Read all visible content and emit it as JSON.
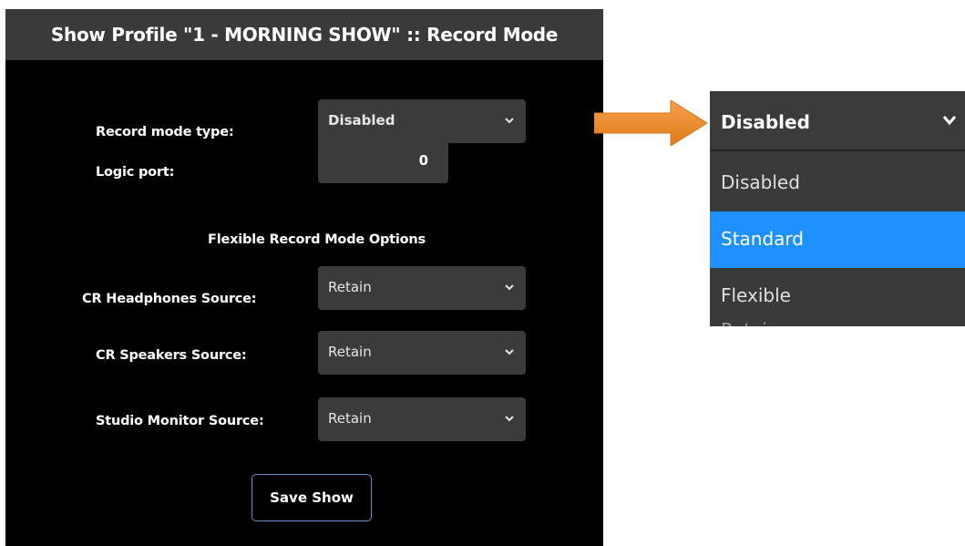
{
  "header": {
    "title": "Show Profile \"1 - MORNING SHOW\" :: Record Mode"
  },
  "form": {
    "record_mode_type": {
      "label": "Record mode type:",
      "value": "Disabled"
    },
    "logic_port": {
      "label": "Logic port:",
      "value": "0"
    },
    "section_title": "Flexible Record Mode Options",
    "cr_headphones": {
      "label": "CR Headphones Source:",
      "value": "Retain"
    },
    "cr_speakers": {
      "label": "CR Speakers Source:",
      "value": "Retain"
    },
    "studio_monitor": {
      "label": "Studio Monitor Source:",
      "value": "Retain"
    },
    "save_label": "Save Show"
  },
  "zoom_dropdown": {
    "selected_value": "Disabled",
    "options": [
      {
        "label": "Disabled",
        "highlighted": false
      },
      {
        "label": "Standard",
        "highlighted": true
      },
      {
        "label": "Flexible",
        "highlighted": false
      }
    ],
    "partial_below": "Retain"
  },
  "colors": {
    "panel_bg": "#000000",
    "header_bg": "#3a3a3a",
    "field_bg": "#3b3b3b",
    "highlight": "#1e90ff",
    "arrow": "#ef8a2a",
    "button_border": "#6b8fc7"
  },
  "icons": {
    "dropdown": "chevron-down-icon",
    "callout": "arrow-right-icon"
  }
}
